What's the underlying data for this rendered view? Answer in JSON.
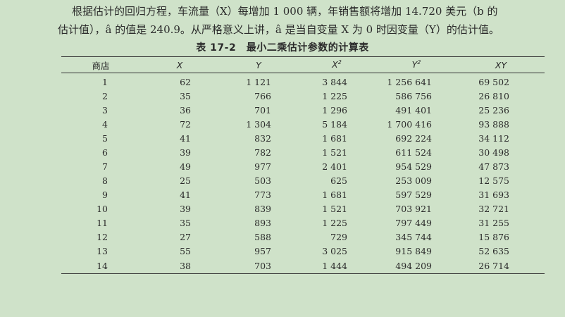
{
  "paragraph": {
    "line1": "根据估计的回归方程，车流量（X）每增加 1 000 辆，年销售额将增加 14.720 美元（b 的",
    "line2": "估计值），â 的值是 240.9。从严格意义上讲，â 是当自变量 X 为 0 时因变量（Y）的估计值。"
  },
  "table": {
    "caption": "表 17-2　最小二乘估计参数的计算表",
    "headers": {
      "store": "商店",
      "x": "X",
      "y": "Y",
      "x2": "X",
      "x2_sup": "2",
      "y2": "Y",
      "y2_sup": "2",
      "xy": "XY"
    },
    "rows": [
      {
        "store": "1",
        "x": "62",
        "y": "1 121",
        "x2": "3 844",
        "y2": "1 256 641",
        "xy": "69 502"
      },
      {
        "store": "2",
        "x": "35",
        "y": "766",
        "x2": "1 225",
        "y2": "586 756",
        "xy": "26 810"
      },
      {
        "store": "3",
        "x": "36",
        "y": "701",
        "x2": "1 296",
        "y2": "491 401",
        "xy": "25 236"
      },
      {
        "store": "4",
        "x": "72",
        "y": "1 304",
        "x2": "5 184",
        "y2": "1 700 416",
        "xy": "93 888"
      },
      {
        "store": "5",
        "x": "41",
        "y": "832",
        "x2": "1 681",
        "y2": "692 224",
        "xy": "34 112"
      },
      {
        "store": "6",
        "x": "39",
        "y": "782",
        "x2": "1 521",
        "y2": "611 524",
        "xy": "30 498"
      },
      {
        "store": "7",
        "x": "49",
        "y": "977",
        "x2": "2 401",
        "y2": "954 529",
        "xy": "47 873"
      },
      {
        "store": "8",
        "x": "25",
        "y": "503",
        "x2": "625",
        "y2": "253 009",
        "xy": "12 575"
      },
      {
        "store": "9",
        "x": "41",
        "y": "773",
        "x2": "1 681",
        "y2": "597 529",
        "xy": "31 693"
      },
      {
        "store": "10",
        "x": "39",
        "y": "839",
        "x2": "1 521",
        "y2": "703 921",
        "xy": "32 721"
      },
      {
        "store": "11",
        "x": "35",
        "y": "893",
        "x2": "1 225",
        "y2": "797 449",
        "xy": "31 255"
      },
      {
        "store": "12",
        "x": "27",
        "y": "588",
        "x2": "729",
        "y2": "345 744",
        "xy": "15 876"
      },
      {
        "store": "13",
        "x": "55",
        "y": "957",
        "x2": "3 025",
        "y2": "915 849",
        "xy": "52 635"
      },
      {
        "store": "14",
        "x": "38",
        "y": "703",
        "x2": "1 444",
        "y2": "494 209",
        "xy": "26 714"
      }
    ]
  }
}
